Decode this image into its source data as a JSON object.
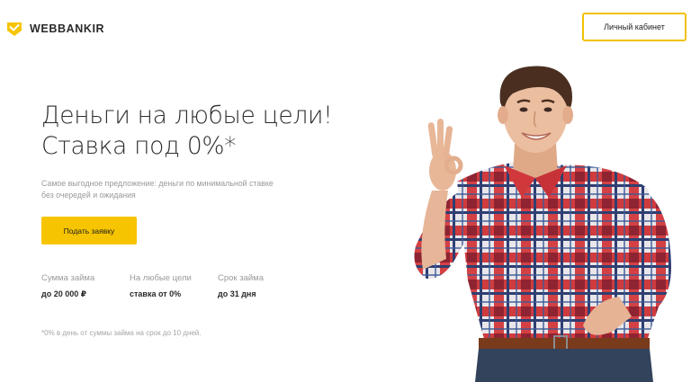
{
  "brand": {
    "name": "WEBBANKIR",
    "accent": "#f6c400"
  },
  "header": {
    "cabinet_label": "Личный кабинет"
  },
  "hero": {
    "title_line1": "Деньги на любые цели!",
    "title_line2": "Ставка под 0%*",
    "subtitle": "Самое выгодное предложение: деньги по минимальной ставке без очередей и ожидания",
    "apply_label": "Подать заявку",
    "photo": "smiling-man-ok-gesture"
  },
  "stats": [
    {
      "label": "Сумма займа",
      "value": "до 20 000 ₽"
    },
    {
      "label": "На любые цели",
      "value": "ставка от 0%"
    },
    {
      "label": "Срок займа",
      "value": "до 31 дня"
    }
  ],
  "footnote": "*0% в день от суммы займа на срок до 10 дней."
}
